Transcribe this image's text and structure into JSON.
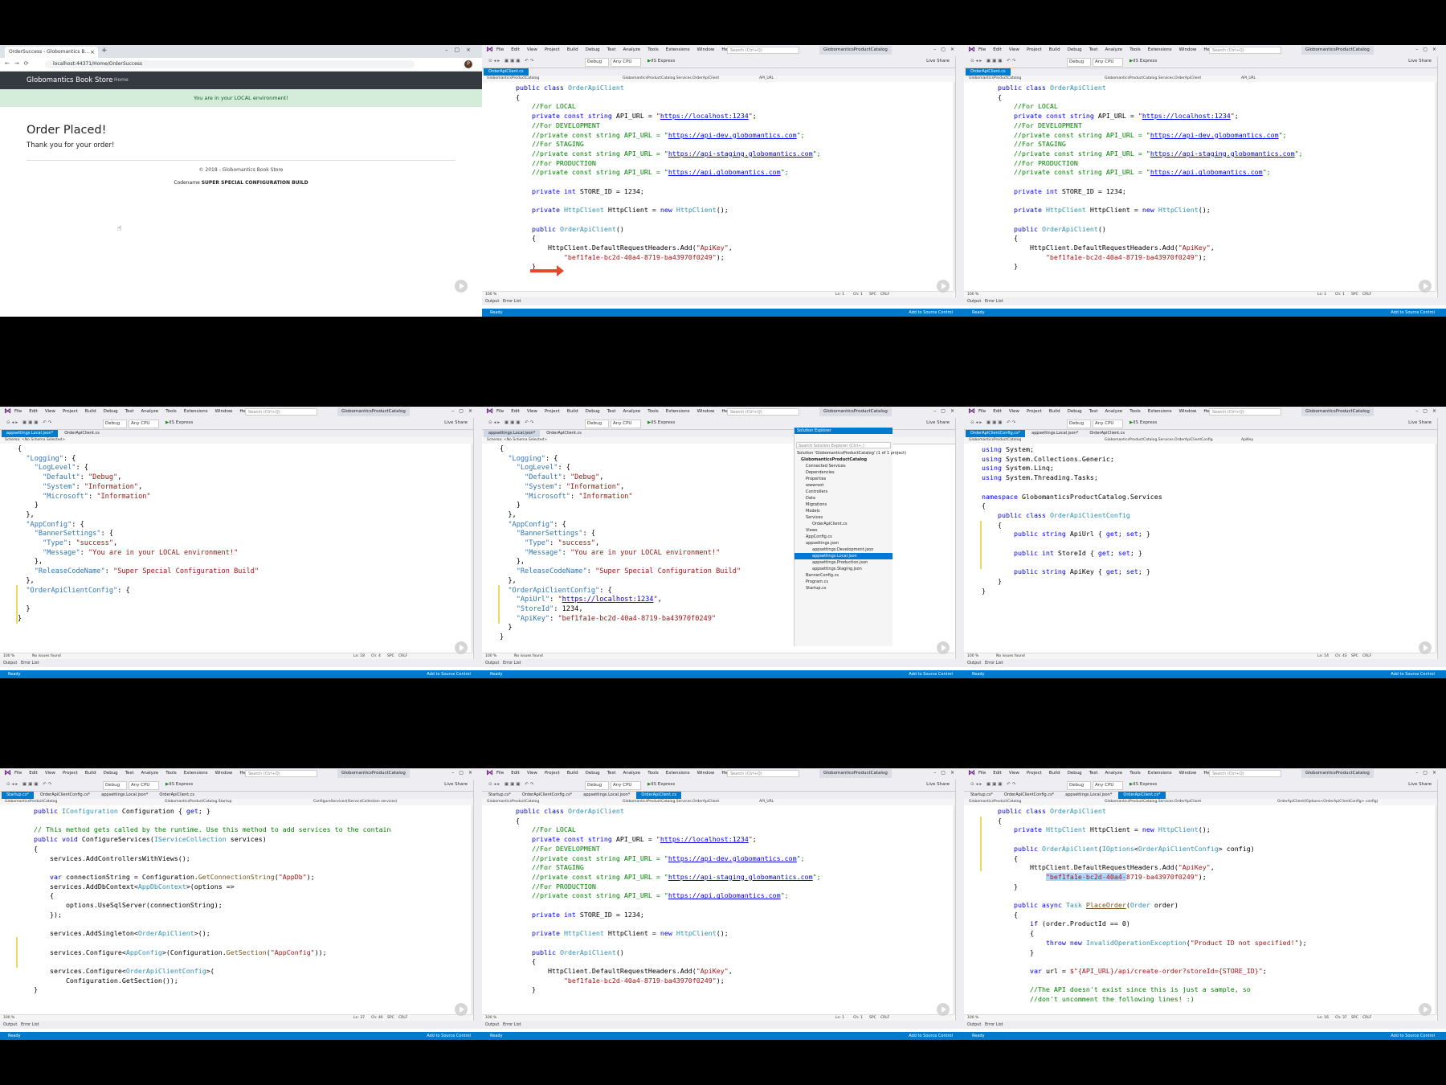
{
  "browser": {
    "tab_title": "OrderSuccess - Globomantics B...",
    "url": "localhost:44371/Home/OrderSuccess",
    "avatar": "P",
    "brand": "Globomantics Book Store",
    "nav_home": "Home",
    "banner": "You are in your LOCAL environment!",
    "heading": "Order Placed!",
    "message": "Thank you for your order!",
    "footer": "© 2018 - Globomantics Book Store",
    "codename_label": "Codename",
    "codename_value": "SUPER SPECIAL CONFIGURATION BUILD"
  },
  "vs": {
    "menu": [
      "File",
      "Edit",
      "View",
      "Project",
      "Build",
      "Debug",
      "Test",
      "Analyze",
      "Tools",
      "Extensions",
      "Window",
      "Help"
    ],
    "search_placeholder": "Search (Ctrl+Q)",
    "solution_name": "GlobomanticsProductCatalog",
    "debug": "Debug",
    "cpu": "Any CPU",
    "iis": "IIS Express",
    "live_share": "Live Share",
    "status_ready": "Ready",
    "source_control": "Add to Source Control",
    "output_tab": "Output",
    "error_tab": "Error List",
    "zoom": "100 %",
    "no_issues": "No issues found",
    "schema": "Schema: <No Schema Selected>",
    "crlf": "CRLF",
    "spc": "SPC"
  },
  "tiles": {
    "t1": {
      "tabs": [
        "OrderApiClient.cs"
      ],
      "active": 0,
      "nav": [
        "GlobomanticsProductCatalog",
        "GlobomanticsProductCatalog.Services.OrderApiClient",
        "API_URL"
      ],
      "status": [
        "Ln: 1",
        "Ch: 1"
      ]
    },
    "t2": {
      "tabs": [
        "OrderApiClient.cs"
      ],
      "active": 0,
      "nav": [
        "GlobomanticsProductCatalog",
        "GlobomanticsProductCatalog.Services.OrderApiClient",
        "API_URL"
      ],
      "status": [
        "Ln: 1",
        "Ch: 1"
      ]
    },
    "t3": {
      "tabs": [
        "appsettings.Local.json*",
        "OrderApiClient.cs"
      ],
      "active": 0,
      "status": [
        "Ln: 18",
        "Ch: 4"
      ]
    },
    "t4": {
      "tabs": [
        "appsettings.Local.json*",
        "OrderApiClient.cs"
      ],
      "active": 0,
      "status": [
        "Ln: 18",
        "Ch: 4"
      ]
    },
    "t5": {
      "tabs": [
        "OrderApiClientConfig.cs*",
        "appsettings.Local.json*",
        "OrderApiClient.cs"
      ],
      "active": 0,
      "nav": [
        "GlobomanticsProductCatalog",
        "GlobomanticsProductCatalog.Services.OrderApiClientConfig",
        "ApiKey"
      ],
      "status": [
        "Ln: 14",
        "Ch: 43"
      ]
    },
    "t6": {
      "tabs": [
        "Startup.cs*",
        "OrderApiClientConfig.cs*",
        "appsettings.Local.json*",
        "OrderApiClient.cs"
      ],
      "active": 0,
      "nav": [
        "GlobomanticsProductCatalog",
        "GlobomanticsProductCatalog.Startup",
        "ConfigureServices(IServiceCollection services)"
      ],
      "status": [
        "Ln: 37",
        "Ch: 40"
      ]
    },
    "t7": {
      "tabs": [
        "Startup.cs*",
        "OrderApiClientConfig.cs*",
        "appsettings.Local.json*",
        "OrderApiClient.cs"
      ],
      "active": 3,
      "nav": [
        "GlobomanticsProductCatalog",
        "GlobomanticsProductCatalog.Services.OrderApiClient",
        "API_URL"
      ],
      "status": [
        "Ln: 1",
        "Ch: 1"
      ]
    },
    "t8": {
      "tabs": [
        "Startup.cs*",
        "OrderApiClientConfig.cs*",
        "appsettings.Local.json*",
        "OrderApiClient.cs*"
      ],
      "active": 3,
      "nav": [
        "GlobomanticsProductCatalog",
        "GlobomanticsProductCatalog.Services.OrderApiClient",
        "OrderApiClient(IOptions<OrderApiClientConfig> config)"
      ],
      "status": [
        "Ln: 16",
        "Ch: 37"
      ]
    }
  },
  "solution_explorer": {
    "title": "Solution Explorer",
    "search": "Search Solution Explorer (Ctrl+;)",
    "items": [
      "Solution 'GlobomanticsProductCatalog' (1 of 1 project)",
      "GlobomanticsProductCatalog",
      "Connected Services",
      "Dependencies",
      "Properties",
      "wwwroot",
      "Controllers",
      "Data",
      "Migrations",
      "Models",
      "Services",
      "OrderApiClient.cs",
      "Views",
      "AppConfig.cs",
      "appsettings.json",
      "appsettings.Development.json",
      "appsettings.Local.json",
      "appsettings.Production.json",
      "appsettings.Staging.json",
      "BannerConfig.cs",
      "Program.cs",
      "Startup.cs"
    ],
    "selected_index": 16
  }
}
